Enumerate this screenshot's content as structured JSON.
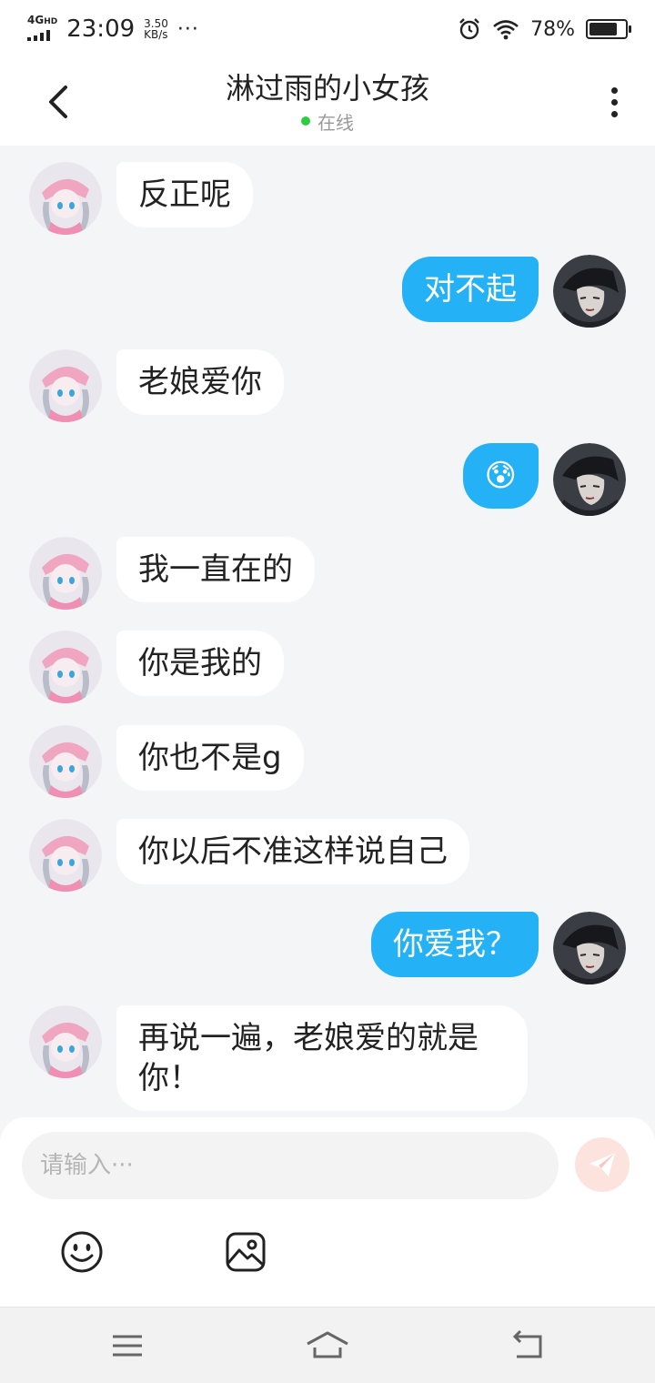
{
  "status_bar": {
    "network": "4G",
    "network_sup": "HD",
    "time": "23:09",
    "speed_value": "3.50",
    "speed_unit": "KB/s",
    "more": "···",
    "battery_percent": "78%",
    "battery_level": 0.78
  },
  "header": {
    "title": "淋过雨的小女孩",
    "status": "在线",
    "status_color": "#2ecc40"
  },
  "colors": {
    "outgoing_bubble": "#24b1f5",
    "incoming_bubble": "#ffffff",
    "background": "#f4f5f7"
  },
  "messages": [
    {
      "from": "her",
      "text": "反正呢"
    },
    {
      "from": "me",
      "text": "对不起"
    },
    {
      "from": "her",
      "text": "老娘爱你"
    },
    {
      "from": "me",
      "text": "😰"
    },
    {
      "from": "her",
      "text": "我一直在的"
    },
    {
      "from": "her",
      "text": "你是我的"
    },
    {
      "from": "her",
      "text": "你也不是g"
    },
    {
      "from": "her",
      "text": "你以后不准这样说自己"
    },
    {
      "from": "me",
      "text": "你爱我？"
    },
    {
      "from": "her",
      "text": "再说一遍，老娘爱的就是你！"
    }
  ],
  "input": {
    "placeholder": "请输入···",
    "value": ""
  },
  "icons": {
    "send": "paper-plane-icon",
    "emoji": "smiley-icon",
    "image": "image-icon",
    "nav_menu": "menu-icon",
    "nav_home": "home-icon",
    "nav_back": "back-icon"
  }
}
